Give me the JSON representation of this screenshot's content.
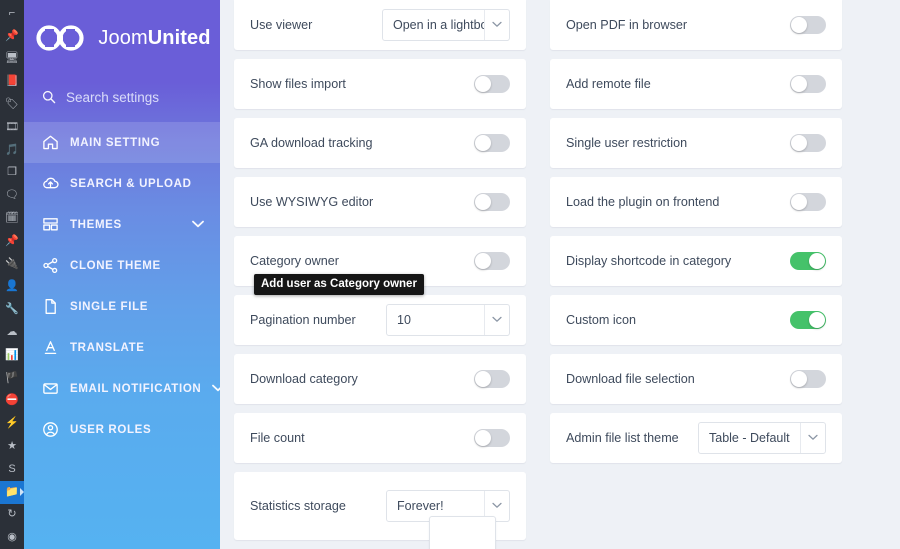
{
  "rail": {
    "icons": [
      {
        "name": "pin-tilt-icon",
        "glyph": "⌐"
      },
      {
        "name": "pushpin-icon",
        "glyph": "📌"
      },
      {
        "name": "window-icon",
        "glyph": "🖥"
      },
      {
        "name": "book-icon",
        "glyph": "📕"
      },
      {
        "name": "tag-icon",
        "glyph": "🏷"
      },
      {
        "name": "film-icon",
        "glyph": "🎞"
      },
      {
        "name": "music-note-icon",
        "glyph": "🎵"
      },
      {
        "name": "copy-icon",
        "glyph": "❐"
      },
      {
        "name": "speech-bubble-icon",
        "glyph": "🗨"
      },
      {
        "name": "calendar-icon",
        "glyph": "🗓"
      },
      {
        "name": "pushpin-small-icon",
        "glyph": "📌"
      },
      {
        "name": "plug-icon",
        "glyph": "🔌"
      },
      {
        "name": "user-icon",
        "glyph": "👤"
      },
      {
        "name": "wrench-icon",
        "glyph": "🔧"
      },
      {
        "name": "cloud-icon",
        "glyph": "☁"
      },
      {
        "name": "chart-icon",
        "glyph": "📊"
      },
      {
        "name": "flag-icon",
        "glyph": "🏴"
      },
      {
        "name": "no-entry-icon",
        "glyph": "⛔"
      },
      {
        "name": "bolt-circle-icon",
        "glyph": "⚡"
      },
      {
        "name": "star-icon",
        "glyph": "★"
      },
      {
        "name": "s-letter-icon",
        "glyph": "S"
      },
      {
        "name": "folder-icon",
        "glyph": "📁",
        "selected": true
      },
      {
        "name": "refresh-icon",
        "glyph": "↻"
      },
      {
        "name": "lifebuoy-icon",
        "glyph": "◉"
      }
    ]
  },
  "sidebar": {
    "brand": {
      "name_light": "Joom",
      "name_bold": "United"
    },
    "search": {
      "placeholder": "Search settings",
      "value": ""
    },
    "items": [
      {
        "label": "MAIN SETTING",
        "icon": "home-icon",
        "active": true,
        "chevron": false
      },
      {
        "label": "SEARCH & UPLOAD",
        "icon": "cloud-upload-icon",
        "active": false,
        "chevron": false
      },
      {
        "label": "THEMES",
        "icon": "layout-icon",
        "active": false,
        "chevron": true
      },
      {
        "label": "CLONE THEME",
        "icon": "share-icon",
        "active": false,
        "chevron": false
      },
      {
        "label": "SINGLE FILE",
        "icon": "file-icon",
        "active": false,
        "chevron": false
      },
      {
        "label": "TRANSLATE",
        "icon": "translate-icon",
        "active": false,
        "chevron": false
      },
      {
        "label": "EMAIL NOTIFICATION",
        "icon": "envelope-icon",
        "active": false,
        "chevron": true
      },
      {
        "label": "USER ROLES",
        "icon": "user-circle-icon",
        "active": false,
        "chevron": false
      }
    ]
  },
  "settings": {
    "left_column": [
      {
        "label": "Use viewer",
        "type": "select",
        "value": "Open in a lightbo:"
      },
      {
        "label": "Show files import",
        "type": "toggle",
        "on": false
      },
      {
        "label": "GA download tracking",
        "type": "toggle",
        "on": false
      },
      {
        "label": "Use WYSIWYG editor",
        "type": "toggle",
        "on": false
      },
      {
        "label": "Category owner",
        "type": "toggle",
        "on": false
      },
      {
        "label": "Pagination number",
        "type": "select",
        "value": "10"
      },
      {
        "label": "Download category",
        "type": "toggle",
        "on": false
      },
      {
        "label": "File count",
        "type": "toggle",
        "on": false
      },
      {
        "label": "Statistics storage",
        "type": "select",
        "value": "Forever!",
        "open": true
      }
    ],
    "right_column": [
      {
        "label": "Open PDF in browser",
        "type": "toggle",
        "on": false
      },
      {
        "label": "Add remote file",
        "type": "toggle",
        "on": false
      },
      {
        "label": "Single user restriction",
        "type": "toggle",
        "on": false
      },
      {
        "label": "Load the plugin on frontend",
        "type": "toggle",
        "on": false
      },
      {
        "label": "Display shortcode in category",
        "type": "toggle",
        "on": true
      },
      {
        "label": "Custom icon",
        "type": "toggle",
        "on": true
      },
      {
        "label": "Download file selection",
        "type": "toggle",
        "on": false
      },
      {
        "label": "Admin file list theme",
        "type": "select",
        "value": "Table - Default"
      }
    ]
  },
  "tooltip": {
    "text": "Add user as Category owner"
  },
  "colors": {
    "sidebar_top": "#6a5ed8",
    "sidebar_bottom": "#55b2f1",
    "toggle_on": "#45c26a",
    "toggle_off": "#d3d6dc",
    "page_bg": "#eef1f6",
    "rail_bg": "#2b3038",
    "tooltip_bg": "#161616"
  }
}
